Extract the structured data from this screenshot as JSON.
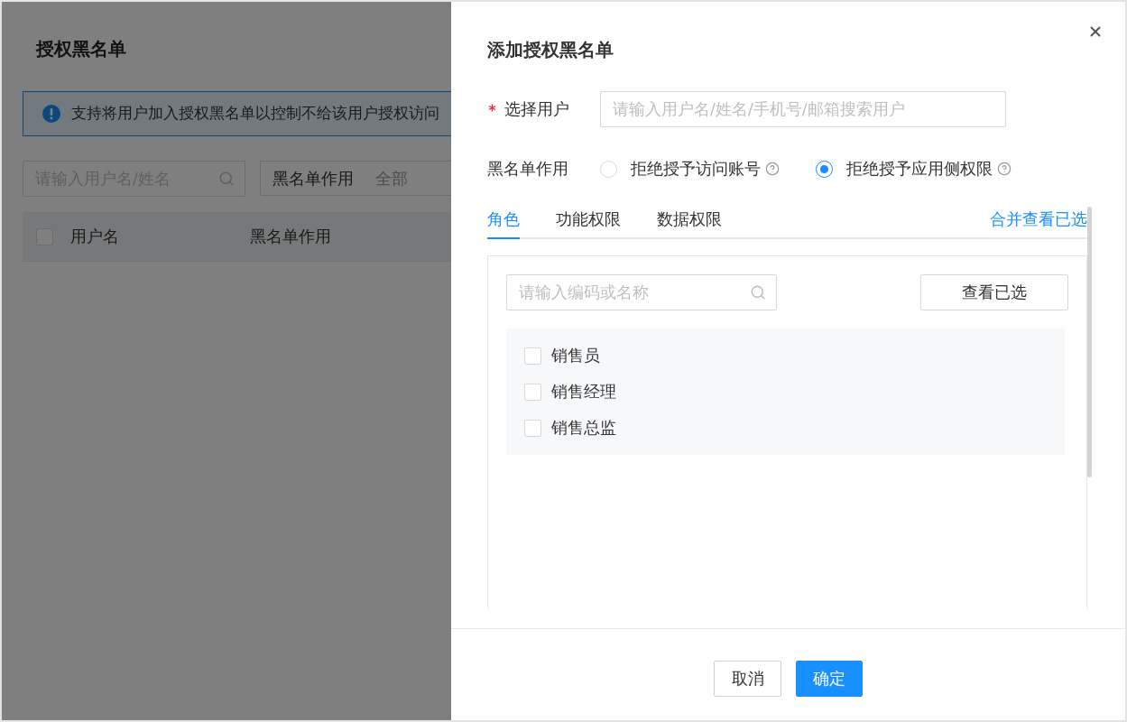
{
  "page": {
    "title": "授权黑名单",
    "notice": "支持将用户加入授权黑名单以控制不给该用户授权访问",
    "search": {
      "placeholder": "请输入用户名/姓名"
    },
    "filter": {
      "label": "黑名单作用",
      "value": "全部"
    },
    "table": {
      "select_all": {
        "checked": false
      },
      "columns": [
        "用户名",
        "黑名单作用"
      ]
    }
  },
  "drawer": {
    "title": "添加授权黑名单",
    "user_field": {
      "label": "选择用户",
      "required": true,
      "placeholder": "请输入用户名/姓名/手机号/邮箱搜索用户"
    },
    "effect_field": {
      "label": "黑名单作用",
      "options": [
        {
          "label": "拒绝授予访问账号",
          "selected": false
        },
        {
          "label": "拒绝授予应用侧权限",
          "selected": true
        }
      ]
    },
    "tabs": [
      {
        "label": "角色",
        "selected": true
      },
      {
        "label": "功能权限",
        "selected": false
      },
      {
        "label": "数据权限",
        "selected": false
      }
    ],
    "merge_link": "合并查看已选",
    "role_panel": {
      "search": {
        "placeholder": "请输入编码或名称"
      },
      "view_selected_button": "查看已选",
      "items": [
        {
          "label": "销售员",
          "checked": false
        },
        {
          "label": "销售经理",
          "checked": false
        },
        {
          "label": "销售总监",
          "checked": false
        }
      ]
    },
    "buttons": [
      {
        "label": "取消",
        "kind": "default"
      },
      {
        "label": "确定",
        "kind": "primary"
      }
    ]
  }
}
